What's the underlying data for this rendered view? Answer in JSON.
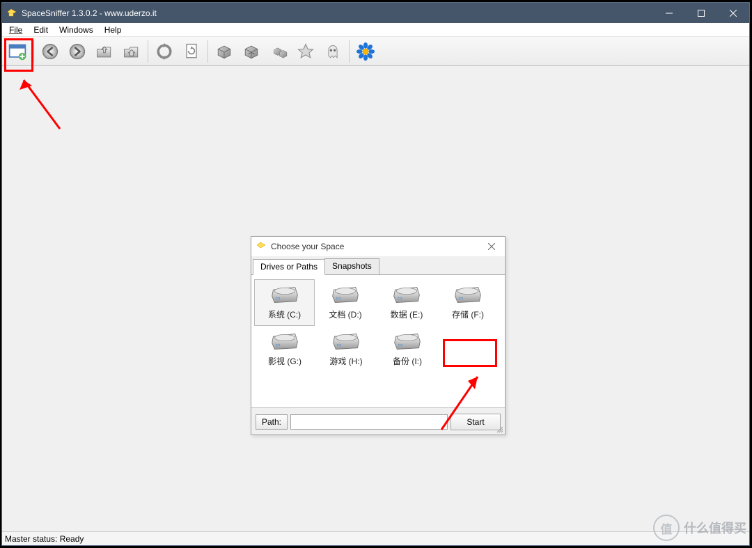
{
  "titlebar": {
    "title": "SpaceSniffer 1.3.0.2 - www.uderzo.it"
  },
  "menu": {
    "file": "File",
    "edit": "Edit",
    "windows": "Windows",
    "help": "Help"
  },
  "toolbar": {
    "new_scan": "New Scan",
    "back": "Back",
    "forward": "Forward",
    "up": "Up",
    "home": "Home",
    "refresh": "Refresh",
    "reload": "Reload",
    "box1": "Less Detail",
    "box2": "More Detail",
    "boxes": "Blocks",
    "star": "Tag",
    "ghost": "Free Space",
    "flower": "About"
  },
  "dialog": {
    "title": "Choose your Space",
    "tabs": {
      "drives": "Drives or Paths",
      "snapshots": "Snapshots"
    },
    "drives": [
      {
        "label": "系统 (C:)",
        "selected": true
      },
      {
        "label": "文档 (D:)",
        "selected": false
      },
      {
        "label": "数据 (E:)",
        "selected": false
      },
      {
        "label": "存储 (F:)",
        "selected": false
      },
      {
        "label": "影视 (G:)",
        "selected": false
      },
      {
        "label": "游戏 (H:)",
        "selected": false
      },
      {
        "label": "备份 (I:)",
        "selected": false
      }
    ],
    "path_label": "Path:",
    "path_value": "",
    "start": "Start"
  },
  "status": {
    "text": "Master status: Ready"
  },
  "watermark": {
    "badge": "值",
    "text": "什么值得买"
  },
  "colors": {
    "titlebar": "#45556a",
    "annotation": "#ff0000"
  }
}
